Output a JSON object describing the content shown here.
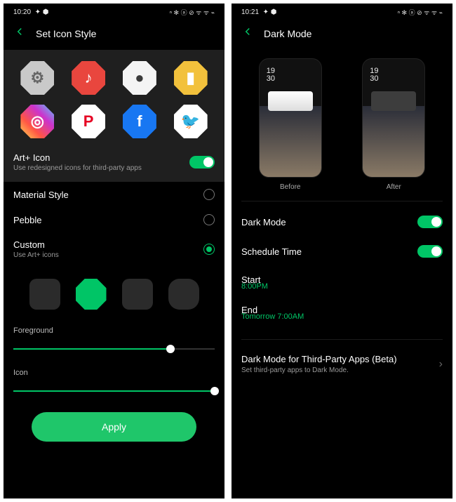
{
  "left": {
    "status": {
      "time": "10:20",
      "indic_left": "✦ ⬢",
      "indic_right": "ⁿ ✻ ⓐ ⊘ ᯤ ᯤ  ⌁"
    },
    "title": "Set Icon Style",
    "icons": {
      "row1": [
        {
          "name": "settings-icon",
          "bg": "#c9c9c9",
          "glyph": "⚙",
          "glyphColor": "#666",
          "octagon": true
        },
        {
          "name": "music-icon",
          "bg": "#e9463e",
          "glyph": "♪",
          "glyphColor": "#fff",
          "octagon": true
        },
        {
          "name": "camera-icon",
          "bg": "#f4f4f4",
          "glyph": "●",
          "glyphColor": "#3a3a3a",
          "octagon": true
        },
        {
          "name": "notes-icon",
          "bg": "#f2c13c",
          "glyph": "▮",
          "glyphColor": "#fff",
          "octagon": true
        }
      ],
      "row2": [
        {
          "name": "instagram-icon",
          "bg": "linear-gradient(45deg,#fd5,#f54,#c3c,#5cf)",
          "glyph": "◎",
          "glyphColor": "#fff",
          "octagon": true
        },
        {
          "name": "pinterest-icon",
          "bg": "#fff",
          "glyph": "P",
          "glyphColor": "#e60023",
          "octagon": true
        },
        {
          "name": "facebook-icon",
          "bg": "#1877f2",
          "glyph": "f",
          "glyphColor": "#fff",
          "octagon": true
        },
        {
          "name": "twitter-icon",
          "bg": "#fff",
          "glyph": "🐦",
          "glyphColor": "#1da1f2",
          "octagon": true
        }
      ]
    },
    "artplus": {
      "title": "Art+ Icon",
      "desc": "Use redesigned icons for third-party apps",
      "on": true
    },
    "styles": [
      {
        "name": "material",
        "label": "Material Style",
        "sub": "",
        "selected": false
      },
      {
        "name": "pebble",
        "label": "Pebble",
        "sub": "",
        "selected": false
      },
      {
        "name": "custom",
        "label": "Custom",
        "sub": "Use Art+ icons",
        "selected": true
      }
    ],
    "shape_selected_index": 1,
    "sliders": {
      "foreground": {
        "label": "Foreground",
        "percent": 78
      },
      "icon": {
        "label": "Icon",
        "percent": 100
      }
    },
    "apply": "Apply"
  },
  "right": {
    "status": {
      "time": "10:21",
      "indic_left": "✦ ⬢",
      "indic_right": "ⁿ ✻ ⓐ ⊘ ᯤ ᯤ  ⌁"
    },
    "title": "Dark Mode",
    "preview": {
      "time_line1": "19",
      "time_line2": "30",
      "before": "Before",
      "after": "After"
    },
    "dark_mode": {
      "label": "Dark Mode",
      "on": true
    },
    "schedule": {
      "label": "Schedule Time",
      "on": true
    },
    "start": {
      "label": "Start",
      "value": "8:00PM"
    },
    "end": {
      "label": "End",
      "value": "Tomorrow 7:00AM"
    },
    "third_party": {
      "label": "Dark Mode for Third-Party Apps (Beta)",
      "desc": "Set third-party apps to Dark Mode."
    }
  }
}
